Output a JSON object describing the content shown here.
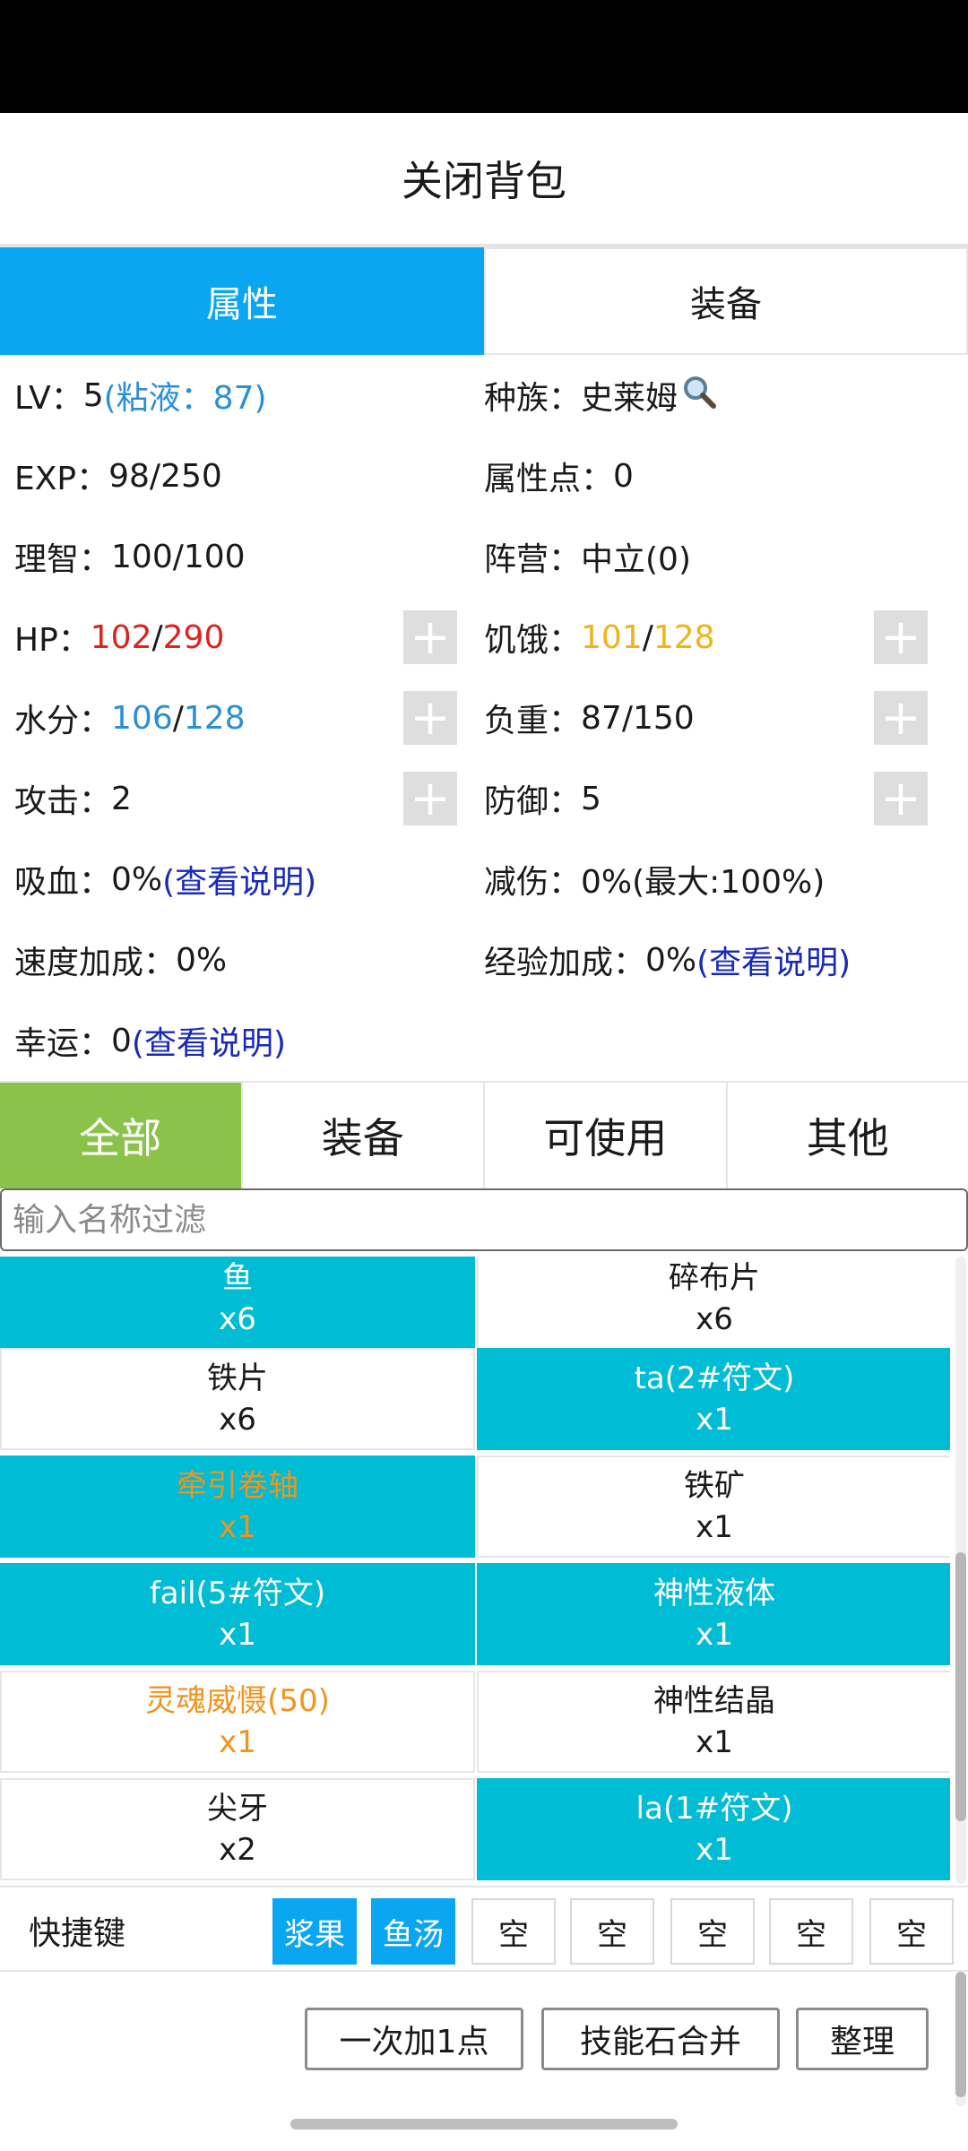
{
  "header": {
    "close_label": "关闭背包"
  },
  "top_tabs": [
    {
      "label": "属性",
      "active": true
    },
    {
      "label": "装备",
      "active": false
    }
  ],
  "stats": {
    "lv_label": "LV：",
    "lv_value": "5",
    "lv_slime": "(粘液：87)",
    "race_label": "种族：",
    "race_value": "史莱姆",
    "exp_label": "EXP：",
    "exp_value": "98/250",
    "attr_points_label": "属性点：",
    "attr_points_value": "0",
    "sanity_label": "理智：",
    "sanity_value": "100/100",
    "faction_label": "阵营：",
    "faction_value": "中立(0)",
    "hp_label": "HP：",
    "hp_cur": "102",
    "hp_sep": "/",
    "hp_max": "290",
    "hunger_label": "饥饿：",
    "hunger_cur": "101",
    "hunger_sep": "/",
    "hunger_max": "128",
    "water_label": "水分：",
    "water_cur": "106",
    "water_sep": "/",
    "water_max": "128",
    "load_label": "负重：",
    "load_value": "87/150",
    "attack_label": "攻击：",
    "attack_value": "2",
    "defense_label": "防御：",
    "defense_value": "5",
    "lifesteal_label": "吸血：",
    "lifesteal_value": "0%",
    "lifesteal_link": "(查看说明)",
    "dmg_reduce_label": "减伤：",
    "dmg_reduce_value": "0%(最大:100%)",
    "speed_label": "速度加成：",
    "speed_value": "0%",
    "exp_bonus_label": "经验加成：",
    "exp_bonus_value": "0%",
    "exp_bonus_link": "(查看说明)",
    "luck_label": "幸运：",
    "luck_value": "0",
    "luck_link": "(查看说明)",
    "plus_label": "+"
  },
  "category_tabs": [
    {
      "label": "全部",
      "active": true
    },
    {
      "label": "装备",
      "active": false
    },
    {
      "label": "可使用",
      "active": false
    },
    {
      "label": "其他",
      "active": false
    }
  ],
  "filter": {
    "placeholder": "输入名称过滤"
  },
  "items": [
    {
      "name": "鱼",
      "count": "x6",
      "style": "teal"
    },
    {
      "name": "碎布片",
      "count": "x6",
      "style": "white"
    },
    {
      "name": "铁片",
      "count": "x6",
      "style": "white"
    },
    {
      "name": "ta(2#符文)",
      "count": "x1",
      "style": "teal"
    },
    {
      "name": "牵引卷轴",
      "count": "x1",
      "style": "teal-orange"
    },
    {
      "name": "铁矿",
      "count": "x1",
      "style": "white"
    },
    {
      "name": "fail(5#符文)",
      "count": "x1",
      "style": "teal"
    },
    {
      "name": "神性液体",
      "count": "x1",
      "style": "teal"
    },
    {
      "name": "灵魂威慑(50)",
      "count": "x1",
      "style": "white-orange"
    },
    {
      "name": "神性结晶",
      "count": "x1",
      "style": "white"
    },
    {
      "name": "尖牙",
      "count": "x2",
      "style": "white"
    },
    {
      "name": "la(1#符文)",
      "count": "x1",
      "style": "teal"
    }
  ],
  "shortcuts": {
    "label": "快捷键",
    "slots": [
      {
        "label": "浆果",
        "filled": true
      },
      {
        "label": "鱼汤",
        "filled": true
      },
      {
        "label": "空",
        "filled": false
      },
      {
        "label": "空",
        "filled": false
      },
      {
        "label": "空",
        "filled": false
      },
      {
        "label": "空",
        "filled": false
      },
      {
        "label": "空",
        "filled": false
      }
    ]
  },
  "actions": {
    "add_one_label": "一次加1点",
    "merge_label": "技能石合并",
    "sort_label": "整理"
  },
  "colors": {
    "tab_active": "#0ba6f2",
    "category_active": "#8bc34a",
    "item_teal": "#00bcd4",
    "hp_red": "#d9251d",
    "hunger_yellow": "#f0b418",
    "water_blue": "#2b8fd6",
    "link_blue": "#1a2ab8",
    "rare_orange": "#f0941e"
  },
  "icons": {
    "race_search": "magnifier-icon"
  }
}
